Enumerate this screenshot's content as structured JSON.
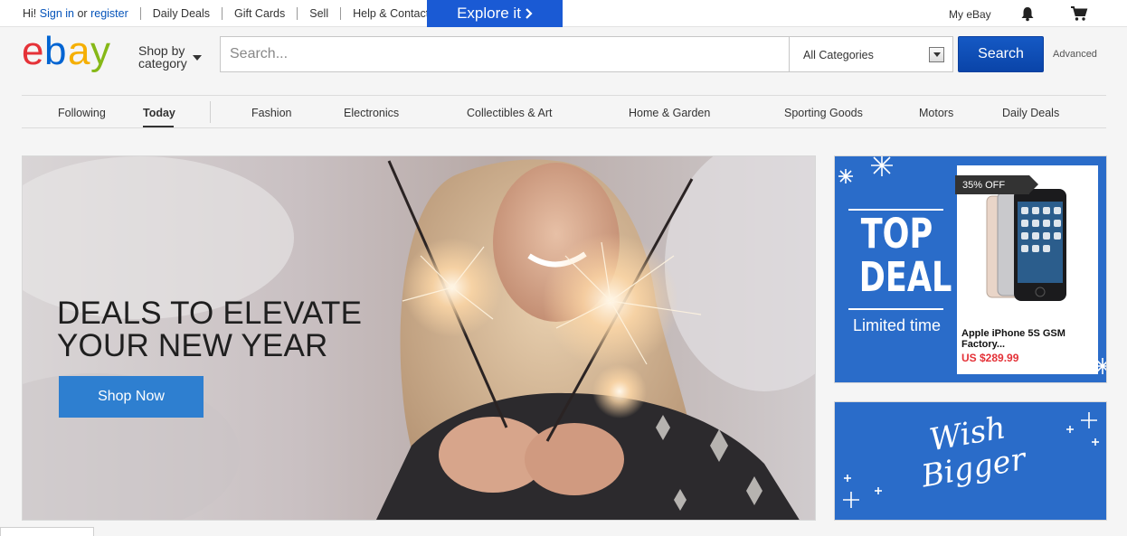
{
  "topbar": {
    "greeting": "Hi!",
    "sign_in": "Sign in",
    "or": "or",
    "register": "register",
    "links": [
      "Daily Deals",
      "Gift Cards",
      "Sell",
      "Help & Contact"
    ],
    "explore": "Explore it",
    "my_ebay": "My eBay"
  },
  "header": {
    "shop_by": "Shop by",
    "category": "category",
    "search_placeholder": "Search...",
    "category_select": "All Categories",
    "search_button": "Search",
    "advanced": "Advanced"
  },
  "nav": {
    "items": [
      "Following",
      "Today",
      "Fashion",
      "Electronics",
      "Collectibles & Art",
      "Home & Garden",
      "Sporting Goods",
      "Motors",
      "Daily Deals"
    ],
    "active": "Today"
  },
  "hero": {
    "line1": "DEALS TO ELEVATE",
    "line2": "YOUR NEW YEAR",
    "cta": "Shop Now"
  },
  "deal": {
    "badge": "35% OFF",
    "top": "TOP",
    "deal": "DEAL",
    "limited": "Limited time",
    "product_name": "Apple iPhone 5S GSM Factory...",
    "price": "US $289.99"
  },
  "wish": {
    "line1": "Wish",
    "line2": "Bigger"
  },
  "colors": {
    "brand_blue": "#0c4fb4",
    "explore_blue": "#1a5ad4",
    "promo_blue": "#2a6cc9",
    "price_red": "#e43137",
    "logo_red": "#e53238",
    "logo_blue": "#0064d2",
    "logo_yellow": "#f5af02",
    "logo_green": "#86b817"
  }
}
